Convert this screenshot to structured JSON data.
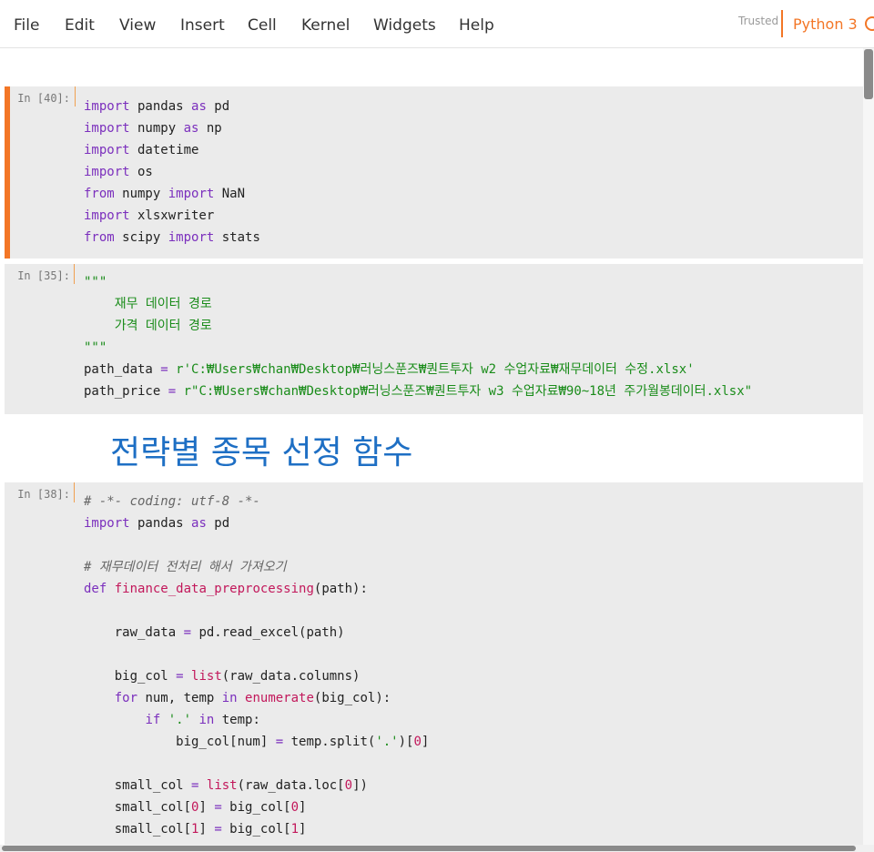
{
  "menu": {
    "items": [
      "File",
      "Edit",
      "View",
      "Insert",
      "Cell",
      "Kernel",
      "Widgets",
      "Help"
    ],
    "trusted": "Trusted",
    "kernel_name": "Python 3"
  },
  "cells": [
    {
      "prompt": "In [40]:",
      "lines": [
        [
          [
            "kw",
            "import"
          ],
          [
            "t",
            " pandas "
          ],
          [
            "kw",
            "as"
          ],
          [
            "t",
            " pd"
          ]
        ],
        [
          [
            "kw",
            "import"
          ],
          [
            "t",
            " numpy "
          ],
          [
            "kw",
            "as"
          ],
          [
            "t",
            " np"
          ]
        ],
        [
          [
            "kw",
            "import"
          ],
          [
            "t",
            " datetime"
          ]
        ],
        [
          [
            "kw",
            "import"
          ],
          [
            "t",
            " os"
          ]
        ],
        [
          [
            "kw",
            "from"
          ],
          [
            "t",
            " numpy "
          ],
          [
            "kw",
            "import"
          ],
          [
            "t",
            " NaN"
          ]
        ],
        [
          [
            "kw",
            "import"
          ],
          [
            "t",
            " xlsxwriter"
          ]
        ],
        [
          [
            "kw",
            "from"
          ],
          [
            "t",
            " scipy "
          ],
          [
            "kw",
            "import"
          ],
          [
            "t",
            " stats"
          ]
        ]
      ]
    },
    {
      "prompt": "In [35]:",
      "lines": [
        [
          [
            "str",
            "\"\"\""
          ]
        ],
        [
          [
            "str",
            "    재무 데이터 경로"
          ]
        ],
        [
          [
            "str",
            "    가격 데이터 경로"
          ]
        ],
        [
          [
            "str",
            "\"\"\""
          ]
        ],
        [
          [
            "t",
            "path_data "
          ],
          [
            "kw",
            "="
          ],
          [
            "t",
            " "
          ],
          [
            "str",
            "r'C:₩Users₩chan₩Desktop₩러닝스푼즈₩퀀트투자 w2 수업자료₩재무데이터 수정.xlsx'"
          ]
        ],
        [
          [
            "t",
            "path_price "
          ],
          [
            "kw",
            "="
          ],
          [
            "t",
            " "
          ],
          [
            "str",
            "r\"C:₩Users₩chan₩Desktop₩러닝스푼즈₩퀀트투자 w3 수업자료₩90~18년 주가월봉데이터.xlsx\""
          ]
        ]
      ]
    },
    {
      "prompt": "In [38]:",
      "lines": [
        [
          [
            "cm",
            "# -*- coding: utf-8 -*-"
          ]
        ],
        [
          [
            "kw",
            "import"
          ],
          [
            "t",
            " pandas "
          ],
          [
            "kw",
            "as"
          ],
          [
            "t",
            " pd"
          ]
        ],
        [
          [
            "t",
            ""
          ]
        ],
        [
          [
            "cm",
            "# 재무데이터 전처리 해서 가져오기"
          ]
        ],
        [
          [
            "kw",
            "def"
          ],
          [
            "t",
            " "
          ],
          [
            "fn",
            "finance_data_preprocessing"
          ],
          [
            "t",
            "(path):"
          ]
        ],
        [
          [
            "t",
            ""
          ]
        ],
        [
          [
            "t",
            "    raw_data "
          ],
          [
            "kw",
            "="
          ],
          [
            "t",
            " pd.read_excel(path)"
          ]
        ],
        [
          [
            "t",
            ""
          ]
        ],
        [
          [
            "t",
            "    big_col "
          ],
          [
            "kw",
            "="
          ],
          [
            "t",
            " "
          ],
          [
            "bi",
            "list"
          ],
          [
            "t",
            "(raw_data.columns)"
          ]
        ],
        [
          [
            "t",
            "    "
          ],
          [
            "kw",
            "for"
          ],
          [
            "t",
            " num, temp "
          ],
          [
            "kw",
            "in"
          ],
          [
            "t",
            " "
          ],
          [
            "bi",
            "enumerate"
          ],
          [
            "t",
            "(big_col):"
          ]
        ],
        [
          [
            "t",
            "        "
          ],
          [
            "kw",
            "if"
          ],
          [
            "t",
            " "
          ],
          [
            "str",
            "'.'"
          ],
          [
            "t",
            " "
          ],
          [
            "kw",
            "in"
          ],
          [
            "t",
            " temp:"
          ]
        ],
        [
          [
            "t",
            "            big_col[num] "
          ],
          [
            "kw",
            "="
          ],
          [
            "t",
            " temp.split("
          ],
          [
            "str",
            "'.'"
          ],
          [
            "t",
            ")["
          ],
          [
            "num",
            "0"
          ],
          [
            "t",
            "]"
          ]
        ],
        [
          [
            "t",
            ""
          ]
        ],
        [
          [
            "t",
            "    small_col "
          ],
          [
            "kw",
            "="
          ],
          [
            "t",
            " "
          ],
          [
            "bi",
            "list"
          ],
          [
            "t",
            "(raw_data.loc["
          ],
          [
            "num",
            "0"
          ],
          [
            "t",
            "])"
          ]
        ],
        [
          [
            "t",
            "    small_col["
          ],
          [
            "num",
            "0"
          ],
          [
            "t",
            "] "
          ],
          [
            "kw",
            "="
          ],
          [
            "t",
            " big_col["
          ],
          [
            "num",
            "0"
          ],
          [
            "t",
            "]"
          ]
        ],
        [
          [
            "t",
            "    small_col["
          ],
          [
            "num",
            "1"
          ],
          [
            "t",
            "] "
          ],
          [
            "kw",
            "="
          ],
          [
            "t",
            " big_col["
          ],
          [
            "num",
            "1"
          ],
          [
            "t",
            "]"
          ]
        ]
      ]
    }
  ],
  "markdown_heading": "전략별 종목 선정 함수",
  "colors": {
    "accent": "#f37626",
    "heading": "#1e6fc4",
    "keyword": "#7b2fbd",
    "string": "#1a8c1a"
  }
}
